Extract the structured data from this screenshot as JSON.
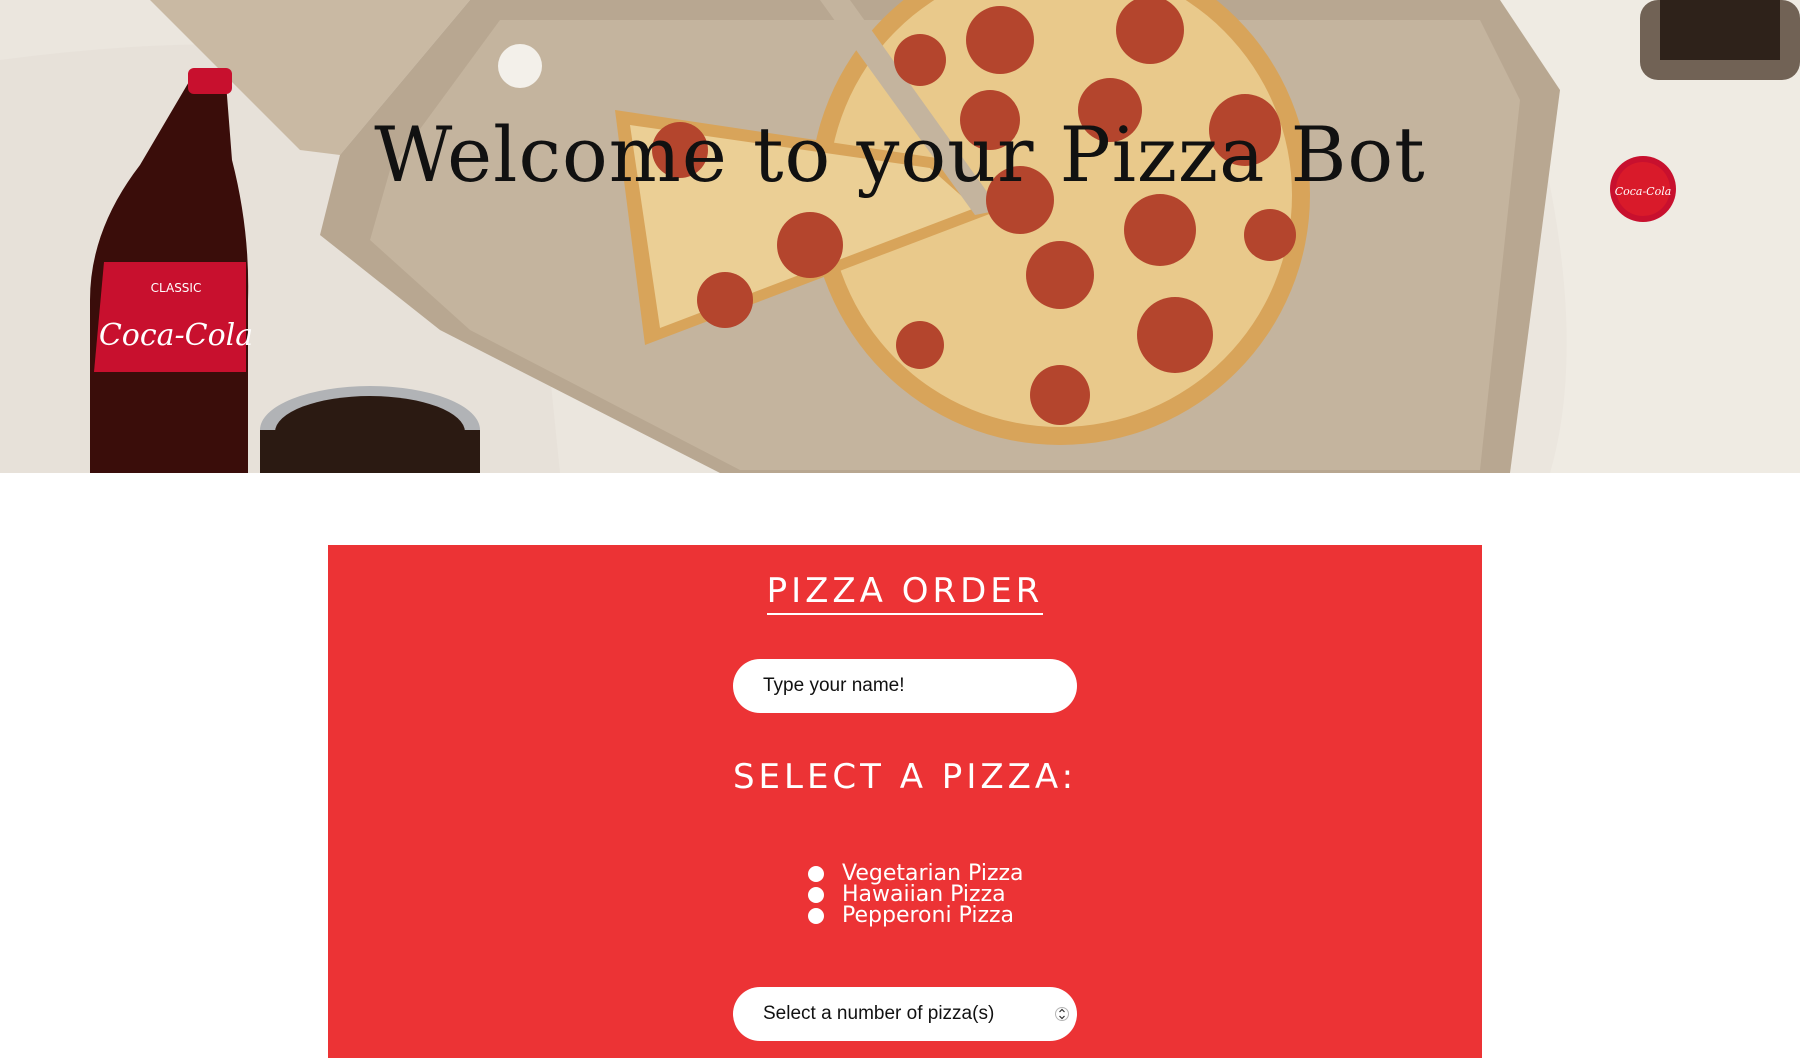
{
  "hero": {
    "title": "Welcome to your Pizza Bot",
    "bottle_label_small": "CLASSIC",
    "bottle_label_brand": "Coca-Cola",
    "cap_label": "Coca-Cola"
  },
  "order": {
    "title": "PIZZA ORDER",
    "name_placeholder": "Type your name!",
    "select_heading": "SELECT A PIZZA:",
    "pizzas": [
      {
        "label": "Vegetarian Pizza"
      },
      {
        "label": "Hawaiian Pizza"
      },
      {
        "label": "Pepperoni Pizza"
      }
    ],
    "quantity_placeholder": "Select a number of pizza(s)"
  },
  "colors": {
    "panel": "#ec3335",
    "panel_text": "#ffffff",
    "hero_title": "#111111"
  }
}
